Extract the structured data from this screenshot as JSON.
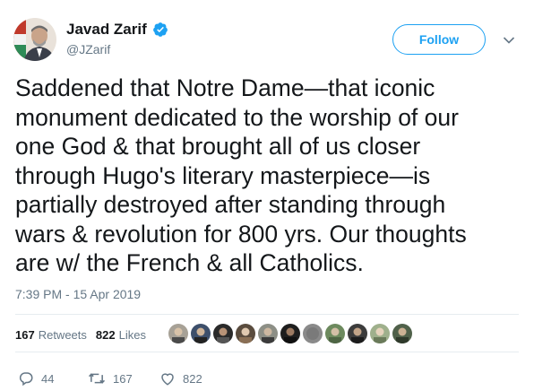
{
  "author": {
    "display_name": "Javad Zarif",
    "handle": "@JZarif",
    "verified": true,
    "avatar_icon": "profile-photo-icon"
  },
  "follow_label": "Follow",
  "tweet_lines": [
    "Saddened that Notre Dame—that iconic",
    "monument dedicated to the worship of our",
    "one God & that brought all of us closer",
    "through Hugo's literary masterpiece—is",
    "partially destroyed after standing through",
    "wars & revolution for 800 yrs. Our thoughts",
    "are w/ the French & all Catholics."
  ],
  "timestamp": "7:39 PM - 15 Apr 2019",
  "stats": {
    "retweets_count": "167",
    "retweets_label": "Retweets",
    "likes_count": "822",
    "likes_label": "Likes"
  },
  "actions": {
    "replies": "44",
    "retweets": "167",
    "likes": "822"
  },
  "colors": {
    "accent": "#1da1f2",
    "muted": "#657786",
    "text": "#14171a",
    "divider": "#e6ecf0"
  }
}
